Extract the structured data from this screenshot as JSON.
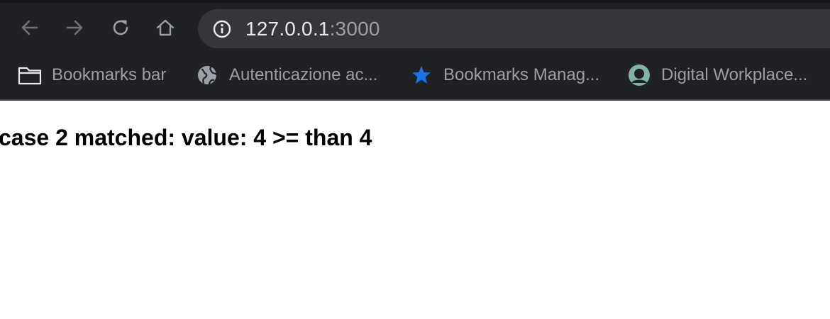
{
  "browser": {
    "address_bar": {
      "host": "127.0.0.1",
      "port": ":3000"
    },
    "nav": {
      "back_icon": "arrow-left-icon",
      "forward_icon": "arrow-right-icon",
      "reload_icon": "reload-icon",
      "home_icon": "home-icon"
    },
    "bookmarks": [
      {
        "label": "Bookmarks bar",
        "icon": "folder-icon"
      },
      {
        "label": "Autenticazione ac...",
        "icon": "globe-icon"
      },
      {
        "label": "Bookmarks Manag...",
        "icon": "star-icon",
        "icon_color": "#1a73e8"
      },
      {
        "label": "Digital Workplace...",
        "icon": "avatar-icon",
        "icon_color": "#7fb3a3"
      }
    ]
  },
  "page": {
    "message": "case 2 matched: value: 4 >= than 4"
  },
  "colors": {
    "chrome_bg": "#202124",
    "omnibox_bg": "#35363a",
    "text_light": "#e8eaed",
    "text_dim": "#9aa0a6"
  }
}
